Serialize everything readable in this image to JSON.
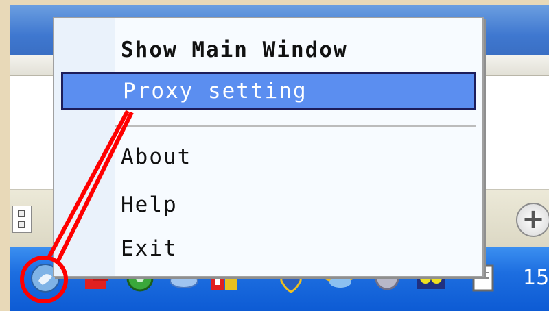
{
  "context_menu": {
    "items": [
      {
        "label": "Show Main Window",
        "bold": true,
        "selected": false
      },
      {
        "label": "Proxy setting",
        "bold": false,
        "selected": true
      },
      {
        "label": "About",
        "bold": false,
        "selected": false
      },
      {
        "label": "Help",
        "bold": false,
        "selected": false
      },
      {
        "label": "Exit",
        "bold": false,
        "selected": false
      }
    ]
  },
  "taskbar": {
    "clock_text": "15",
    "tray_icons": [
      "app-globe-icon",
      "network-icon",
      "green-disc-icon",
      "link-icon",
      "ime-icon",
      "shield-icon",
      "messenger-icon",
      "sound-icon",
      "bluetooth-icon",
      "notepad-icon"
    ]
  },
  "statusbar": {
    "zoom_symbol": "+"
  },
  "colors": {
    "taskbar": "#1d6ee0",
    "menu_highlight": "#5b8ef0",
    "annotation": "#ff0000"
  }
}
